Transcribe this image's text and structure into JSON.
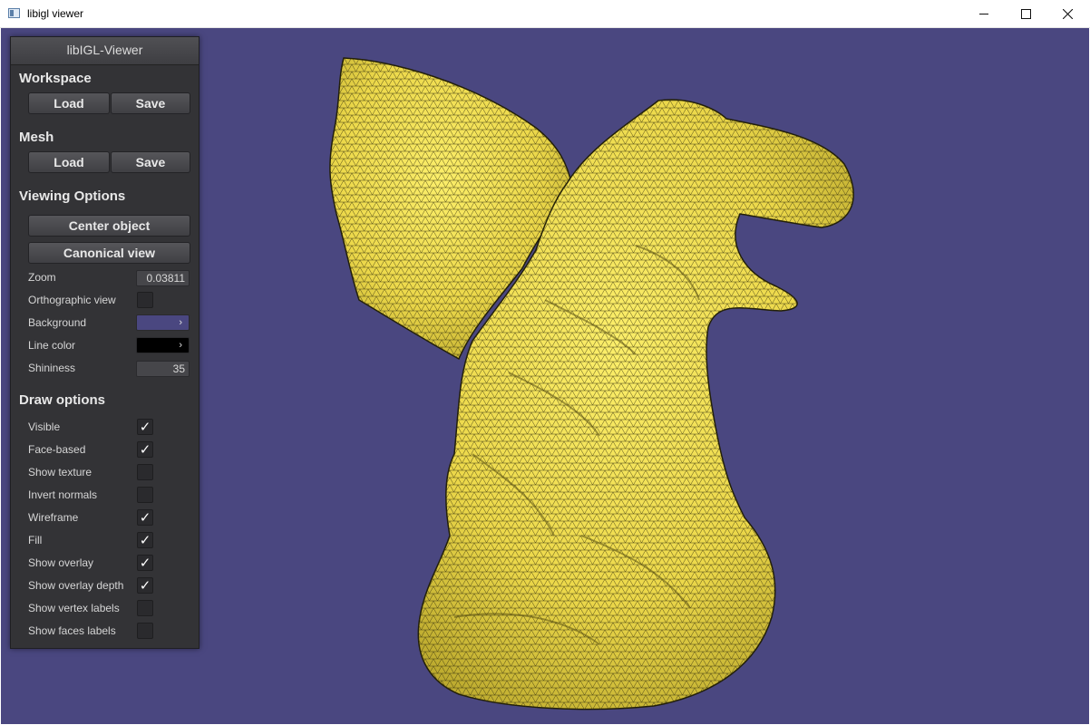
{
  "window": {
    "title": "libigl viewer",
    "icon": "app-window-icon",
    "controls": {
      "minimize": "minimize-icon",
      "maximize": "maximize-icon",
      "close": "close-icon"
    }
  },
  "viewport": {
    "background_color": "#4a4780",
    "model_color": "#f2e14a",
    "wire_color": "#000000"
  },
  "panel": {
    "title": "libIGL-Viewer",
    "workspace": {
      "title": "Workspace",
      "load": "Load",
      "save": "Save"
    },
    "mesh": {
      "title": "Mesh",
      "load": "Load",
      "save": "Save"
    },
    "viewing": {
      "title": "Viewing Options",
      "center_object": "Center object",
      "canonical_view": "Canonical view",
      "zoom_label": "Zoom",
      "zoom_value": "0.03811",
      "orthographic_label": "Orthographic view",
      "orthographic_checked": false,
      "background_label": "Background",
      "background_color": "#4a4780",
      "line_color_label": "Line color",
      "line_color": "#000000",
      "shininess_label": "Shininess",
      "shininess_value": "35"
    },
    "draw": {
      "title": "Draw options",
      "options": [
        {
          "label": "Visible",
          "checked": true
        },
        {
          "label": "Face-based",
          "checked": true
        },
        {
          "label": "Show texture",
          "checked": false
        },
        {
          "label": "Invert normals",
          "checked": false
        },
        {
          "label": "Wireframe",
          "checked": true
        },
        {
          "label": "Fill",
          "checked": true
        },
        {
          "label": "Show overlay",
          "checked": true
        },
        {
          "label": "Show overlay depth",
          "checked": true
        },
        {
          "label": "Show vertex labels",
          "checked": false
        },
        {
          "label": "Show faces labels",
          "checked": false
        }
      ]
    },
    "check_glyph": "✓",
    "arrow_glyph": "›"
  }
}
